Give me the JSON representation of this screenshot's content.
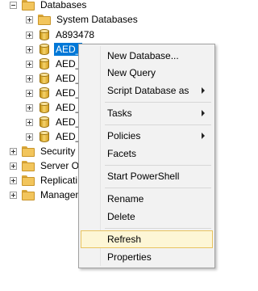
{
  "tree": {
    "databases_label": "Databases",
    "system_databases_label": "System Databases",
    "db_a893478_label": "A893478",
    "selected_db_label": "AED_",
    "db_rows": [
      "AED_",
      "AED_",
      "AED_",
      "AED_",
      "AED_",
      "AED_"
    ],
    "security_label": "Security",
    "server_objects_label": "Server Ol",
    "replication_label": "Replicati",
    "management_label": "Managen"
  },
  "context_menu": {
    "items": [
      "New Database...",
      "New Query",
      "Script Database as",
      "Tasks",
      "Policies",
      "Facets",
      "Start PowerShell",
      "Rename",
      "Delete",
      "Refresh",
      "Properties"
    ],
    "hovered_item": "Refresh"
  }
}
